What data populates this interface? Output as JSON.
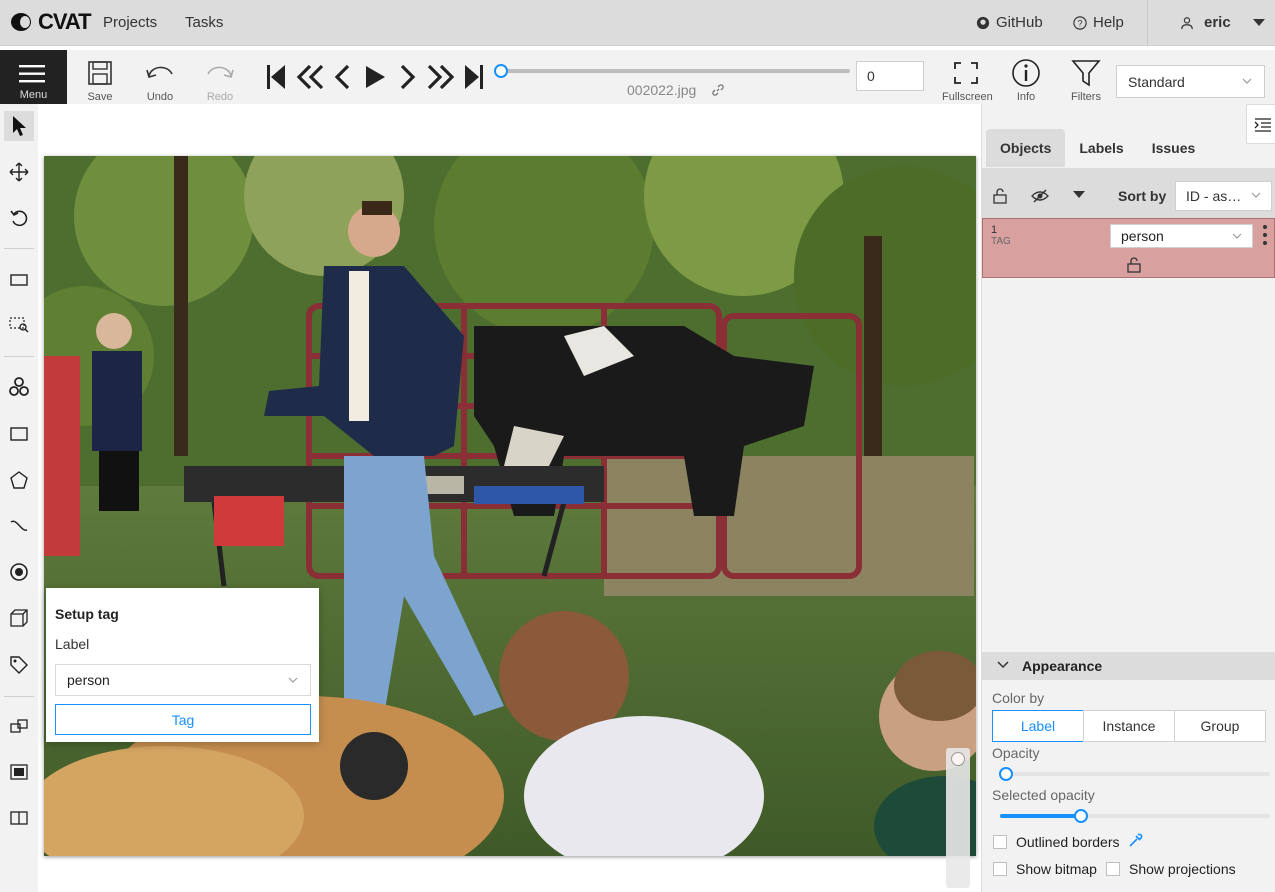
{
  "header": {
    "logo_text": "CVAT",
    "nav": [
      "Projects",
      "Tasks"
    ],
    "github": "GitHub",
    "help": "Help",
    "user": "eric"
  },
  "toolbar": {
    "menu": "Menu",
    "save": "Save",
    "undo": "Undo",
    "redo": "Redo",
    "filename": "002022.jpg",
    "frame": "0",
    "fullscreen": "Fullscreen",
    "info": "Info",
    "filters": "Filters",
    "workspace": "Standard"
  },
  "popover": {
    "title": "Setup tag",
    "label_caption": "Label",
    "label_value": "person",
    "tag_button": "Tag"
  },
  "sidebar": {
    "tabs": [
      "Objects",
      "Labels",
      "Issues"
    ],
    "sort_by": "Sort by",
    "sort_value": "ID - as…",
    "object": {
      "id": "1",
      "type": "TAG",
      "label": "person"
    }
  },
  "appearance": {
    "title": "Appearance",
    "color_by": "Color by",
    "color_options": [
      "Label",
      "Instance",
      "Group"
    ],
    "color_selected": "Label",
    "opacity": "Opacity",
    "opacity_level": 0.03,
    "selected_opacity": "Selected opacity",
    "selected_opacity_level": 0.3,
    "outlined_borders": "Outlined borders",
    "show_bitmap": "Show bitmap",
    "show_projections": "Show projections"
  },
  "colors": {
    "accent": "#1890ff",
    "object_bg": "#d9a0a0",
    "header_bg": "#dcdcdc"
  }
}
